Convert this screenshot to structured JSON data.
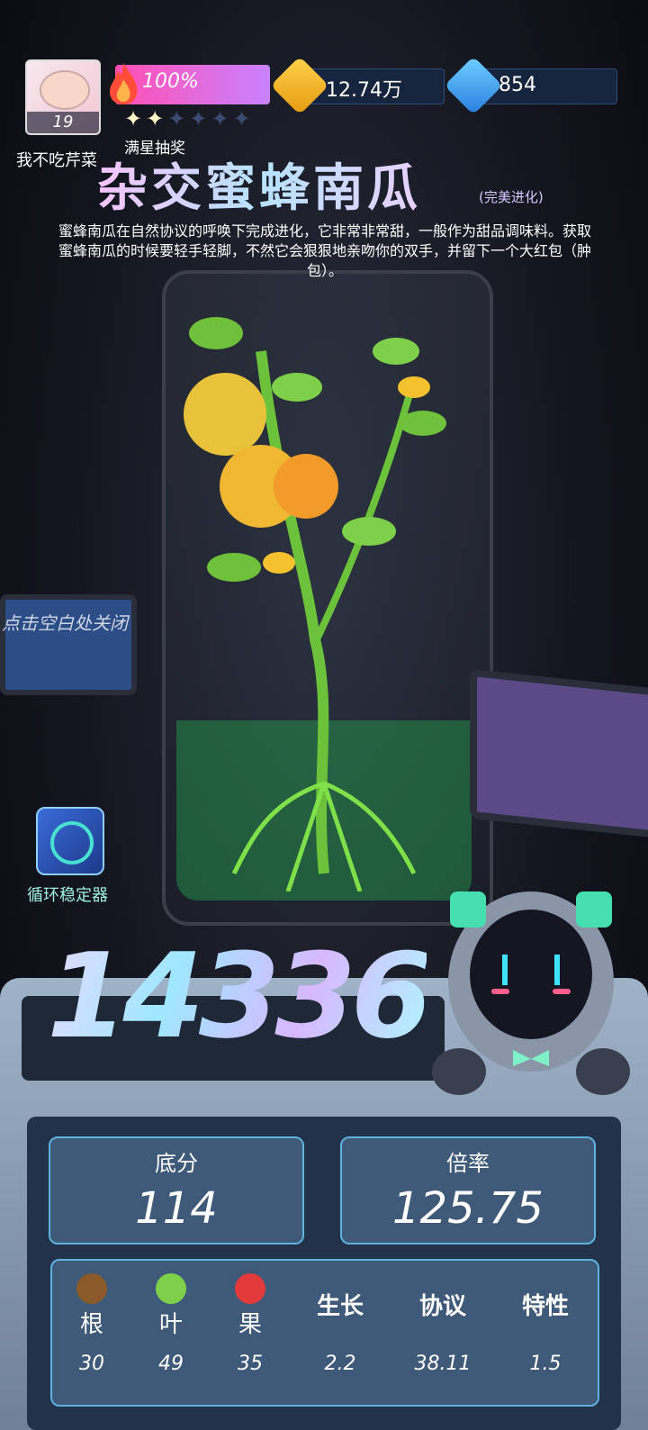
{
  "player": {
    "level": "19",
    "name": "我不吃芹菜"
  },
  "energy": {
    "percent_label": "100%",
    "stars_filled": 2,
    "stars_total": 6
  },
  "currency": {
    "coins": "12.74万",
    "gems": "854"
  },
  "lottery_label": "满星抽奖",
  "plant": {
    "title": "杂交蜜蜂南瓜",
    "evolution_tag": "(完美进化)",
    "description": "蜜蜂南瓜在自然协议的呼唤下完成进化，它非常非常甜，一般作为甜品调味料。获取蜜蜂南瓜的时候要轻手轻脚，不然它会狠狠地亲吻你的双手，并留下一个大红包（肿包）。"
  },
  "close_hint": "点击空白处关闭",
  "stabilizer_label": "循环稳定器",
  "total_score": "14336",
  "base_score": {
    "label": "底分",
    "value": "114"
  },
  "multiplier": {
    "label": "倍率",
    "value": "125.75"
  },
  "stats": [
    {
      "label": "根",
      "value": "30",
      "icon": "root-icon"
    },
    {
      "label": "叶",
      "value": "49",
      "icon": "leaf-icon"
    },
    {
      "label": "果",
      "value": "35",
      "icon": "fruit-icon"
    },
    {
      "label": "生长",
      "value": "2.2"
    },
    {
      "label": "协议",
      "value": "38.11"
    },
    {
      "label": "特性",
      "value": "1.5"
    }
  ]
}
